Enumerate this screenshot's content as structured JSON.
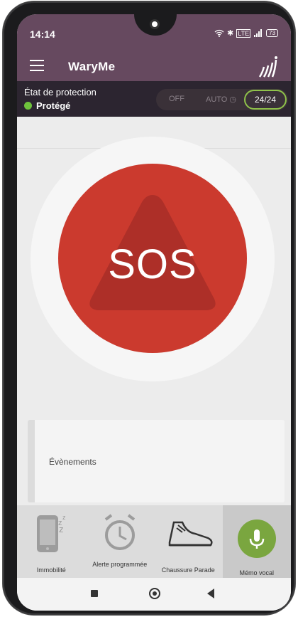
{
  "status_bar": {
    "time": "14:14",
    "icons": [
      "wifi-icon",
      "bluetooth-icon",
      "lte-icon",
      "signal-icon",
      "battery-icon"
    ],
    "battery": "73"
  },
  "app_bar": {
    "title": "WaryMe",
    "menu_icon": "hamburger-menu-icon",
    "logo_icon": "wary-signal-logo-icon"
  },
  "protection": {
    "label": "État de protection",
    "status": "Protégé",
    "status_color": "#6ec23c",
    "modes": {
      "off": "OFF",
      "auto": "AUTO",
      "full": "24/24",
      "selected": "24/24"
    }
  },
  "sos": {
    "label": "SOS",
    "color": "#cb3a2e"
  },
  "events": {
    "title": "Évènements"
  },
  "shortcuts": [
    {
      "label": "Immobilité",
      "icon": "phone-sleep-icon"
    },
    {
      "label": "Alerte programmée",
      "icon": "alarm-clock-icon"
    },
    {
      "label": "Chaussure Parade",
      "icon": "shoe-icon"
    },
    {
      "label": "Mémo vocal",
      "icon": "microphone-icon",
      "active": true
    }
  ],
  "colors": {
    "primary": "#66495f",
    "accent_green": "#7aa63f",
    "sos_red": "#cb3a2e"
  }
}
